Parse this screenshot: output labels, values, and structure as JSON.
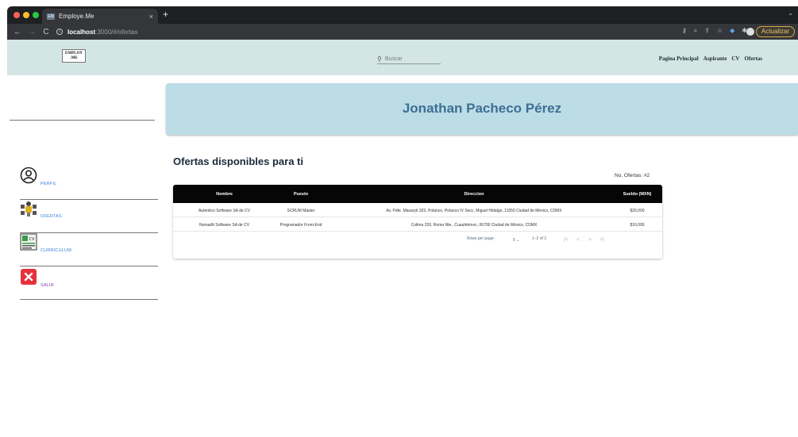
{
  "browser": {
    "tab_title": "Employe.Me",
    "tab_close": "×",
    "new_tab": "+",
    "address_host": "localhost",
    "address_path": ":3000/#/ofertas",
    "update_label": "Actualizar",
    "colors": {
      "tabbar": "#1f2023",
      "toolbar": "#35363a"
    }
  },
  "header": {
    "logo_text_1": "EMPLOY",
    "logo_text_2": ".ME",
    "search_placeholder": "Buscar",
    "nav_links": [
      "Pagina Principal",
      "Aspirante",
      "CV",
      "Ofertas"
    ]
  },
  "sidebar": {
    "items": [
      {
        "label": "PERFIL",
        "icon": "profile-icon",
        "color": "#3b82d8"
      },
      {
        "label": "OFERTAS",
        "icon": "offers-icon",
        "color": "#3b82d8"
      },
      {
        "label": "CURRICULUM",
        "icon": "cv-icon",
        "color": "#3b82d8"
      },
      {
        "label": "SALIR",
        "icon": "logout-icon",
        "color": "#7b3ea8"
      }
    ]
  },
  "banner": {
    "name": "Jonathan Pacheco Pérez",
    "color": "#bcdde6"
  },
  "main": {
    "heading": "Ofertas disponibles para ti",
    "count_label": "No. Ofertas: #2"
  },
  "table": {
    "columns": [
      "Nombre",
      "Puesto",
      "Direccion",
      "Sueldo (MXN)"
    ],
    "rows": [
      [
        "Autentico Software SA de CV",
        "SCRUM Master",
        "Av. Pdte. Masaryk 323, Polanco, Polanco IV Secc, Miguel Hidalgo, 11550 Ciudad de México, CDMX",
        "$20,000"
      ],
      [
        "Nomadtt Software SA de CV",
        "Programador Front-End",
        "Colima 220, Roma Nte., Cuauhtémoc, 06700 Ciudad de México, CDMX",
        "$10,000"
      ]
    ],
    "pagination": {
      "rows_per_page_label": "Rows per page:",
      "rows_per_page_value": "5",
      "range": "1–2 of 2"
    }
  }
}
